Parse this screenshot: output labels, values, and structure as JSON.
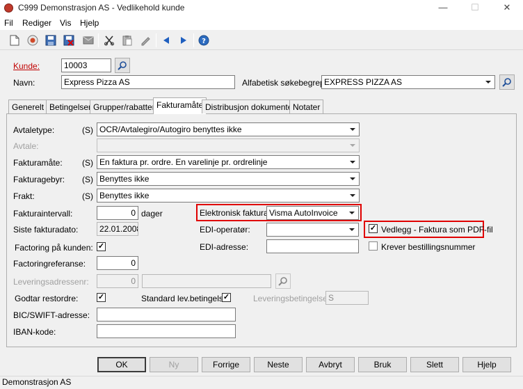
{
  "window": {
    "title": "C999 Demonstrasjon AS - Vedlikehold kunde",
    "minimize": "—",
    "maximize": "☐",
    "close": "✕"
  },
  "menu": [
    "Fil",
    "Rediger",
    "Vis",
    "Hjelp"
  ],
  "toolbar": {
    "icons": [
      "new-document-icon",
      "globe-icon",
      "save-icon",
      "delete-save-icon",
      "email-icon",
      "cut-icon",
      "paste-icon",
      "edit-icon",
      "back-arrow-icon",
      "forward-arrow-icon",
      "help-icon"
    ]
  },
  "header": {
    "kunde_label": "Kunde:",
    "kunde_value": "10003",
    "navn_label": "Navn:",
    "navn_value": "Express Pizza AS",
    "alfa_label": "Alfabetisk søkebegrep:",
    "alfa_value": "EXPRESS PIZZA AS"
  },
  "tabs": [
    "Generelt",
    "Betingelser",
    "Grupper/rabatter",
    "Fakturamåte",
    "Distribusjon dokumenter",
    "Notater"
  ],
  "active_tab": "Fakturamåte",
  "form": {
    "avtaletype_label": "Avtaletype:",
    "avtaletype_s": "(S)",
    "avtaletype_value": "OCR/Avtalegiro/Autogiro benyttes ikke",
    "avtale_label": "Avtale:",
    "avtale_value": "",
    "fakturamate_label": "Fakturamåte:",
    "fakturamate_s": "(S)",
    "fakturamate_value": "En faktura pr. ordre. En varelinje pr. ordrelinje",
    "fakturagebyr_label": "Fakturagebyr:",
    "fakturagebyr_s": "(S)",
    "fakturagebyr_value": "Benyttes ikke",
    "frakt_label": "Frakt:",
    "frakt_s": "(S)",
    "frakt_value": "Benyttes ikke",
    "fakturaintervall_label": "Fakturaintervall:",
    "fakturaintervall_value": "0",
    "dager_label": "dager",
    "siste_label": "Siste fakturadato:",
    "siste_value": "22.01.2008",
    "factoring_label": "Factoring på kunden:",
    "factoring_checked": "✓",
    "factoringref_label": "Factoringreferanse:",
    "factoringref_value": "0",
    "levadr_label": "Leveringsadressenr:",
    "levadr_value": "0",
    "levadr_text": "",
    "godtar_label": "Godtar restordre:",
    "godtar_checked": "✓",
    "standard_label": "Standard lev.betingelse:",
    "standard_checked": "✓",
    "levbet_label": "Leveringsbetingelse:",
    "levbet_value": "S",
    "bic_label": "BIC/SWIFT-adresse:",
    "bic_value": "",
    "iban_label": "IBAN-kode:",
    "iban_value": "",
    "efaktura_label": "Elektronisk faktura:",
    "efaktura_value": "Visma AutoInvoice",
    "edioperator_label": "EDI-operatør:",
    "edioperator_value": "",
    "ediadresse_label": "EDI-adresse:",
    "ediadresse_value": "",
    "vedlegg_label": "Vedlegg - Faktura som PDF-fil",
    "vedlegg_checked": "✓",
    "krever_label": "Krever bestillingsnummer",
    "krever_checked": ""
  },
  "buttons": {
    "ok": "OK",
    "ny": "Ny",
    "forrige": "Forrige",
    "neste": "Neste",
    "avbryt": "Avbryt",
    "bruk": "Bruk",
    "slett": "Slett",
    "hjelp": "Hjelp"
  },
  "status": "Demonstrasjon AS",
  "colors": {
    "highlight_box": "#e00000",
    "required_label": "#c00000",
    "nav_arrows": "#1f5fbf"
  }
}
